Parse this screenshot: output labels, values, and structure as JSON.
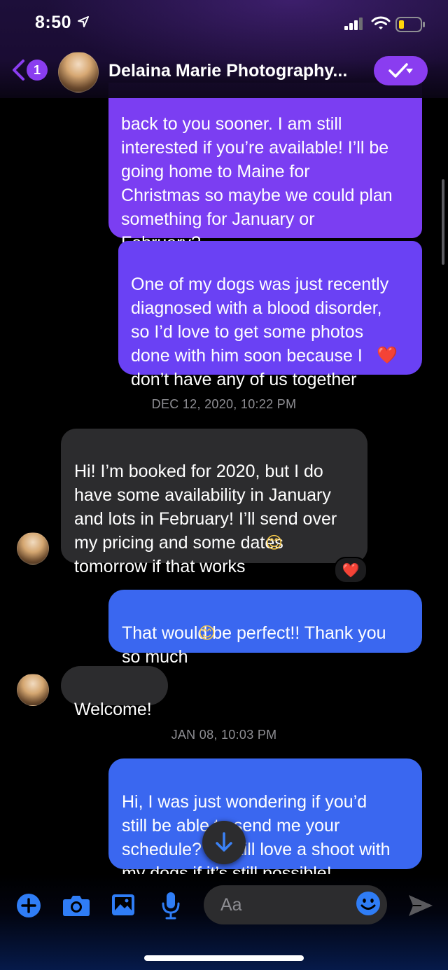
{
  "status_bar": {
    "time": "8:50"
  },
  "header": {
    "back_badge": "1",
    "title": "Delaina Marie Photography..."
  },
  "colors": {
    "accent_purple": "#8a3df0",
    "outgoing_purple": "#7b3ef2",
    "outgoing_blue": "#3a67f0",
    "incoming_gray": "#2c2c2e"
  },
  "messages": [
    {
      "direction": "outgoing",
      "text": "back to you sooner. I am still\ninterested if you’re available! I’ll be\ngoing home to Maine for\nChristmas so maybe we could plan\nsomething for January or\nFebruary?"
    },
    {
      "direction": "outgoing",
      "text": "One of my dogs was just recently\ndiagnosed with a blood disorder,\nso I’d love to get some photos\ndone with him soon because I\ndon’t have any of us together",
      "emoji": "❤️"
    },
    {
      "direction": "incoming",
      "text": "Hi! I’m booked for 2020, but I do\nhave some availability in January\nand lots in February! I’ll send over\nmy pricing and some dates\ntomorrow if that works",
      "emoji": "😊",
      "reaction": "❤️"
    },
    {
      "direction": "outgoing",
      "text": "That would be perfect!! Thank you\nso much",
      "emoji": "😊"
    },
    {
      "direction": "incoming",
      "text": "Welcome!"
    },
    {
      "direction": "outgoing",
      "text": "Hi, I was just wondering if you’d\nstill be able to send me your\nschedule? I’d still love a shoot with\nmy dogs if it’s still possible!"
    }
  ],
  "timestamps": [
    "DEC 12, 2020, 10:22 PM",
    "JAN 08, 10:03 PM"
  ],
  "composer": {
    "placeholder": "Aa",
    "icons": [
      "plus-icon",
      "camera-icon",
      "gallery-icon",
      "microphone-icon",
      "emoji-icon",
      "send-icon"
    ]
  }
}
